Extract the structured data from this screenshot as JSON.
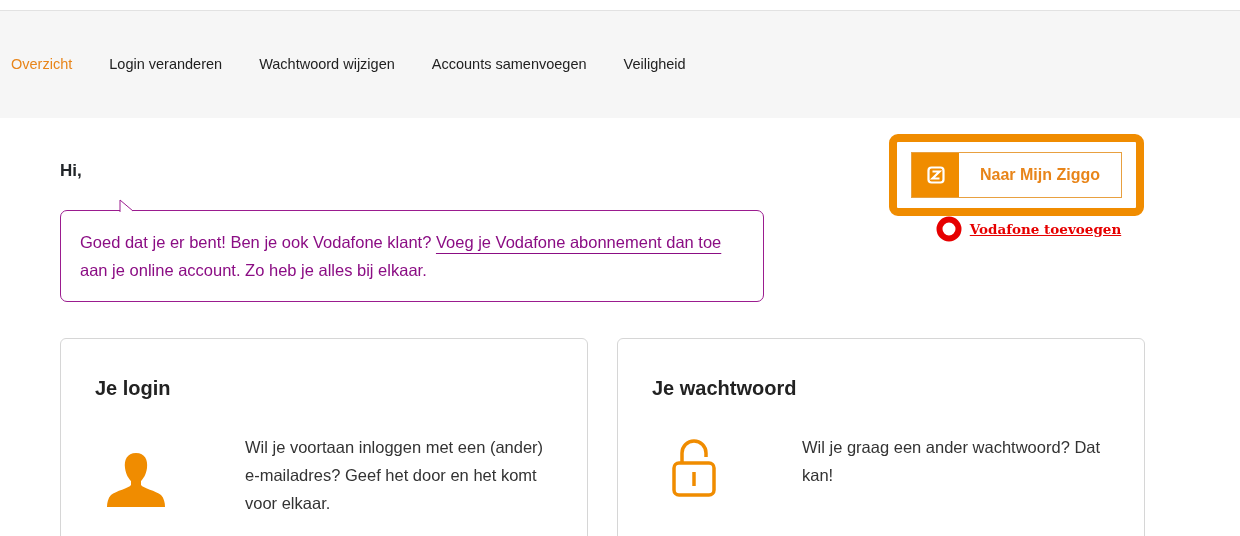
{
  "tabs": [
    {
      "label": "Overzicht",
      "selected": true
    },
    {
      "label": "Login veranderen",
      "selected": false
    },
    {
      "label": "Wachtwoord wijzigen",
      "selected": false
    },
    {
      "label": "Accounts samenvoegen",
      "selected": false
    },
    {
      "label": "Veiligheid",
      "selected": false
    }
  ],
  "greeting": "Hi,",
  "callout": {
    "before": "Goed dat je er bent! Ben je ook Vodafone klant? ",
    "link": "Voeg je Vodafone abonnement dan toe",
    "after": " aan je online account. Zo heb je alles bij elkaar."
  },
  "ziggo_button": {
    "label": "Naar Mijn Ziggo"
  },
  "vodafone_link": {
    "label": "Vodafone toevoegen"
  },
  "cards": [
    {
      "kind": "login",
      "title": "Je login",
      "text": "Wil je voortaan inloggen met een (ander) e-mailadres? Geef het door en het komt voor elkaar."
    },
    {
      "kind": "password",
      "title": "Je wachtwoord",
      "text": "Wil je graag een ander wachtwoord? Dat kan!"
    }
  ]
}
